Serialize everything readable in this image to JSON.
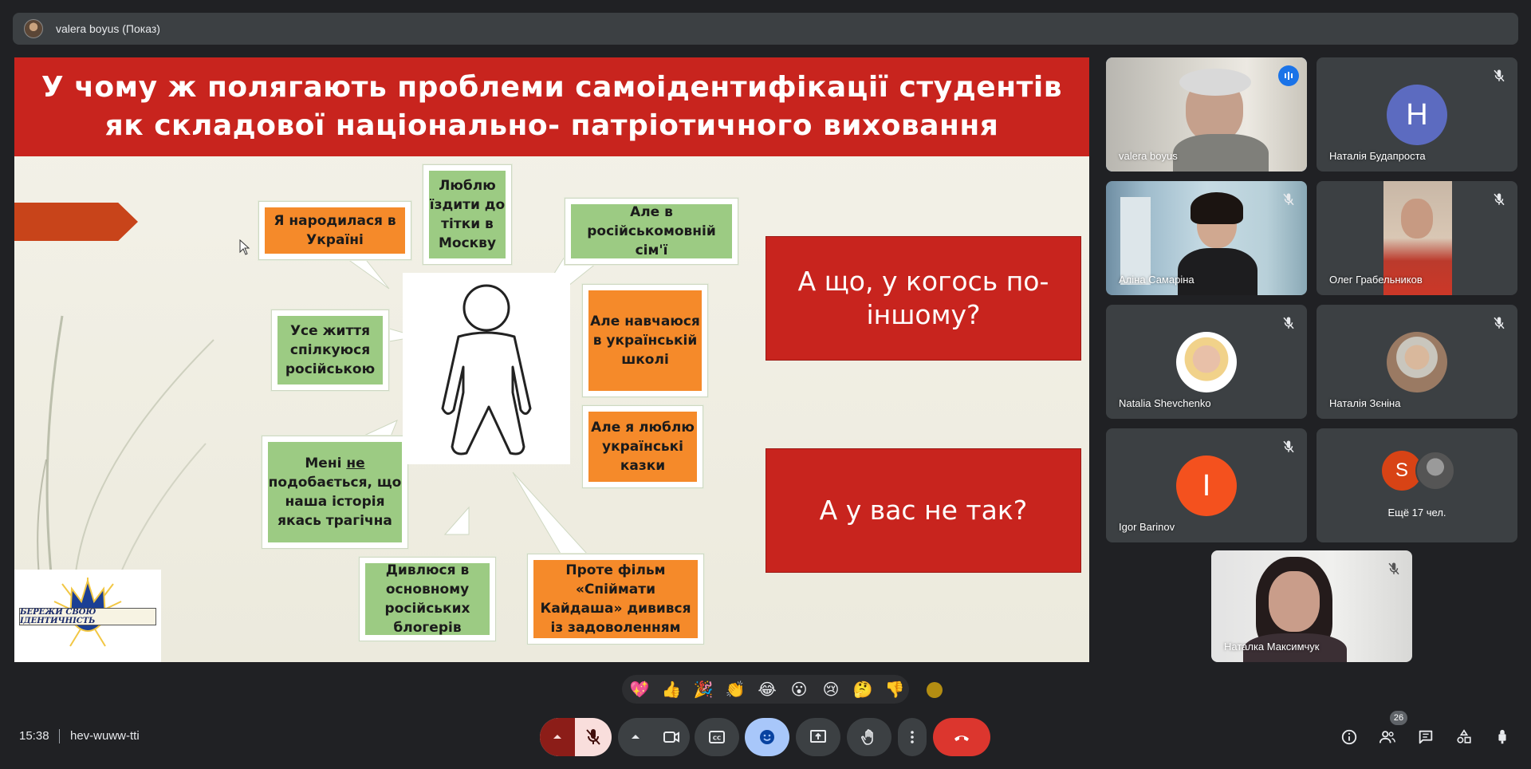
{
  "presenter_bar": {
    "title": "valera boyus (Показ)"
  },
  "slide": {
    "title": "У чому ж полягають проблеми самоідентифікації студентів як складової національно- патріотичного виховання",
    "bubbles": [
      {
        "text": "Я народилася в Україні",
        "color": "orange"
      },
      {
        "text": "Люблю їздити до тітки в Москву",
        "color": "green"
      },
      {
        "text": "Але в російськомовній сім'ї",
        "color": "green"
      },
      {
        "text": "Усе життя спілкуюся російською",
        "color": "green"
      },
      {
        "text": "Але навчаюся в українській школі",
        "color": "orange"
      },
      {
        "text": "Але я люблю українські казки",
        "color": "orange"
      },
      {
        "text_before": "Мені ",
        "text_underlined": "не",
        "text_after": " подобається, що наша історія якась трагічна",
        "color": "green"
      },
      {
        "text": "Дивлюся в основному російських блогерів",
        "color": "green"
      },
      {
        "text": "Проте фільм «Спіймати Кайдаша» дивився із задоволенням",
        "color": "orange"
      }
    ],
    "red_boxes": [
      "А що, у когось по-іншому?",
      "А у вас не так?"
    ],
    "logo_text": "БЕРЕЖИ СВОЮ ІДЕНТИЧНІСТЬ"
  },
  "participants": [
    {
      "name": "valera boyus",
      "type": "video",
      "speaking": true
    },
    {
      "name": "Наталія Будапроста",
      "type": "letter",
      "letter": "Н",
      "color": "#5c6bc0"
    },
    {
      "name": "Аліна Самаріна",
      "type": "video"
    },
    {
      "name": "Олег Грабельников",
      "type": "video"
    },
    {
      "name": "Natalia Shevchenko",
      "type": "photo"
    },
    {
      "name": "Наталія Зєніна",
      "type": "photo"
    },
    {
      "name": "Igor Barinov",
      "type": "letter",
      "letter": "I",
      "color": "#f4511e"
    },
    {
      "name": "Наталка Максимчук",
      "type": "video"
    }
  ],
  "more_tile": {
    "label": "Ещё 17 чел.",
    "letter": "S",
    "color": "#d84315"
  },
  "reactions": [
    "💖",
    "👍",
    "🎉",
    "👏",
    "😂",
    "😮",
    "😢",
    "🤔",
    "👎"
  ],
  "bottom_bar": {
    "time": "15:38",
    "meeting_code": "hev-wuww-tti",
    "participant_count": "26"
  },
  "colors": {
    "background": "#202124",
    "tile": "#3c4043",
    "accent": "#8ab4f8",
    "slide_red": "#c8241e",
    "end_call": "#dc362e"
  }
}
